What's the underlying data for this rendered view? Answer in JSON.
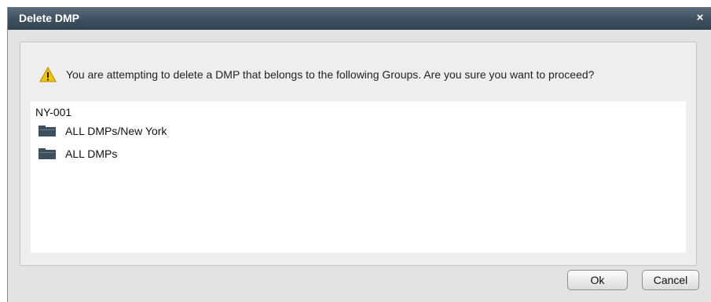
{
  "dialog": {
    "title": "Delete DMP",
    "close_label": "×",
    "warning_message": "You are attempting to delete a DMP that belongs to the following Groups. Are you sure you want to proceed?",
    "device_name": "NY-001",
    "groups": [
      {
        "label": "ALL DMPs/New York",
        "icon": "folder-icon"
      },
      {
        "label": "ALL DMPs",
        "icon": "folder-icon"
      }
    ],
    "buttons": {
      "ok_label": "Ok",
      "cancel_label": "Cancel"
    }
  },
  "colors": {
    "titlebar": "#3e5060",
    "dialog_background": "#e3e3e3",
    "warning_icon": "#f2c400",
    "folder_icon": "#3d4f5c"
  }
}
